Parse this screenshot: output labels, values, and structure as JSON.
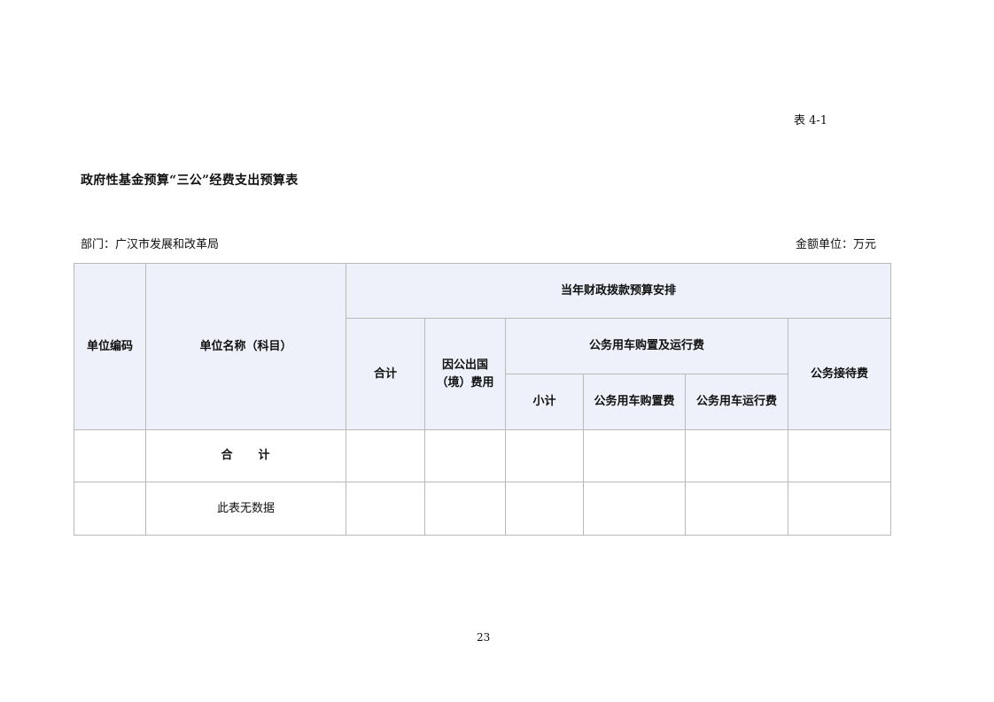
{
  "header": {
    "table_label": "表 4-1",
    "title": "政府性基金预算“三公”经费支出预算表",
    "department": "部门：广汉市发展和改革局",
    "unit": "金额单位：万元"
  },
  "table": {
    "headers": {
      "unit_code": "单位编码",
      "unit_name": "单位名称（科目）",
      "appropriation": "当年财政拨款预算安排",
      "total": "合计",
      "overseas_line1": "因公出国",
      "overseas_line2": "（境）费用",
      "vehicle_group": "公务用车购置及运行费",
      "subtotal": "小计",
      "vehicle_purchase": "公务用车购置费",
      "vehicle_operation": "公务用车运行费",
      "reception": "公务接待费"
    },
    "rows": [
      {
        "code": "",
        "name": "合　　计",
        "total": "",
        "overseas": "",
        "subtotal": "",
        "purchase": "",
        "operation": "",
        "reception": ""
      },
      {
        "code": "",
        "name": "此表无数据",
        "total": "",
        "overseas": "",
        "subtotal": "",
        "purchase": "",
        "operation": "",
        "reception": ""
      }
    ]
  },
  "footer": {
    "page_number": "23"
  }
}
